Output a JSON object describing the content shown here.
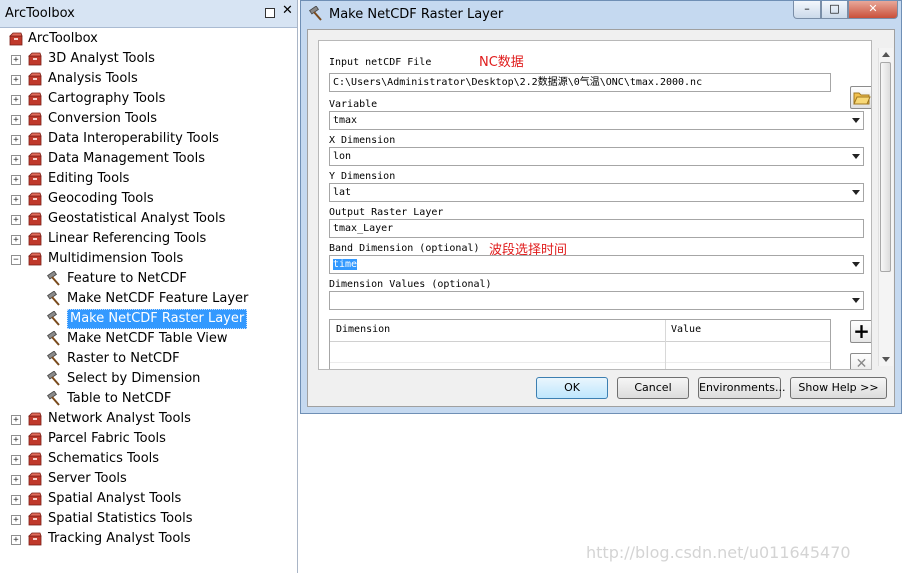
{
  "toolbox": {
    "title": "ArcToolbox",
    "root": "ArcToolbox",
    "items": [
      {
        "label": "3D Analyst Tools",
        "expander": "+"
      },
      {
        "label": "Analysis Tools",
        "expander": "+"
      },
      {
        "label": "Cartography Tools",
        "expander": "+"
      },
      {
        "label": "Conversion Tools",
        "expander": "+"
      },
      {
        "label": "Data Interoperability Tools",
        "expander": "+"
      },
      {
        "label": "Data Management Tools",
        "expander": "+"
      },
      {
        "label": "Editing Tools",
        "expander": "+"
      },
      {
        "label": "Geocoding Tools",
        "expander": "+"
      },
      {
        "label": "Geostatistical Analyst Tools",
        "expander": "+"
      },
      {
        "label": "Linear Referencing Tools",
        "expander": "+"
      },
      {
        "label": "Multidimension Tools",
        "expander": "−"
      }
    ],
    "multidimension_tools": [
      "Feature to NetCDF",
      "Make NetCDF Feature Layer",
      "Make NetCDF Raster Layer",
      "Make NetCDF Table View",
      "Raster to NetCDF",
      "Select by Dimension",
      "Table to NetCDF"
    ],
    "selected_tool": "Make NetCDF Raster Layer",
    "items_after": [
      {
        "label": "Network Analyst Tools",
        "expander": "+"
      },
      {
        "label": "Parcel Fabric Tools",
        "expander": "+"
      },
      {
        "label": "Schematics Tools",
        "expander": "+"
      },
      {
        "label": "Server Tools",
        "expander": "+"
      },
      {
        "label": "Spatial Analyst Tools",
        "expander": "+"
      },
      {
        "label": "Spatial Statistics Tools",
        "expander": "+"
      },
      {
        "label": "Tracking Analyst Tools",
        "expander": "+"
      }
    ]
  },
  "dialog": {
    "title": "Make NetCDF Raster Layer",
    "window_buttons": {
      "minimize": "–",
      "maximize": "□",
      "close": "✕"
    },
    "params": {
      "input_label": "Input netCDF File",
      "input_value": "C:\\Users\\Administrator\\Desktop\\2.2数据源\\0气温\\ONC\\tmax.2000.nc",
      "variable_label": "Variable",
      "variable_value": "tmax",
      "x_label": "X Dimension",
      "x_value": "lon",
      "y_label": "Y Dimension",
      "y_value": "lat",
      "output_label": "Output Raster Layer",
      "output_value": "tmax_Layer",
      "band_label": "Band Dimension (optional)",
      "band_value": "time",
      "dimvals_label": "Dimension Values (optional)",
      "dimvals_value": ""
    },
    "table": {
      "col_dimension": "Dimension",
      "col_value": "Value"
    },
    "annotations": {
      "nc": "NC数据",
      "band": "波段选择时间"
    },
    "buttons": {
      "ok": "OK",
      "cancel": "Cancel",
      "environments": "Environments...",
      "show_help": "Show Help >>"
    },
    "table_buttons": {
      "add": "+",
      "remove": "✕"
    }
  },
  "watermark": "http://blog.csdn.net/u011645470"
}
